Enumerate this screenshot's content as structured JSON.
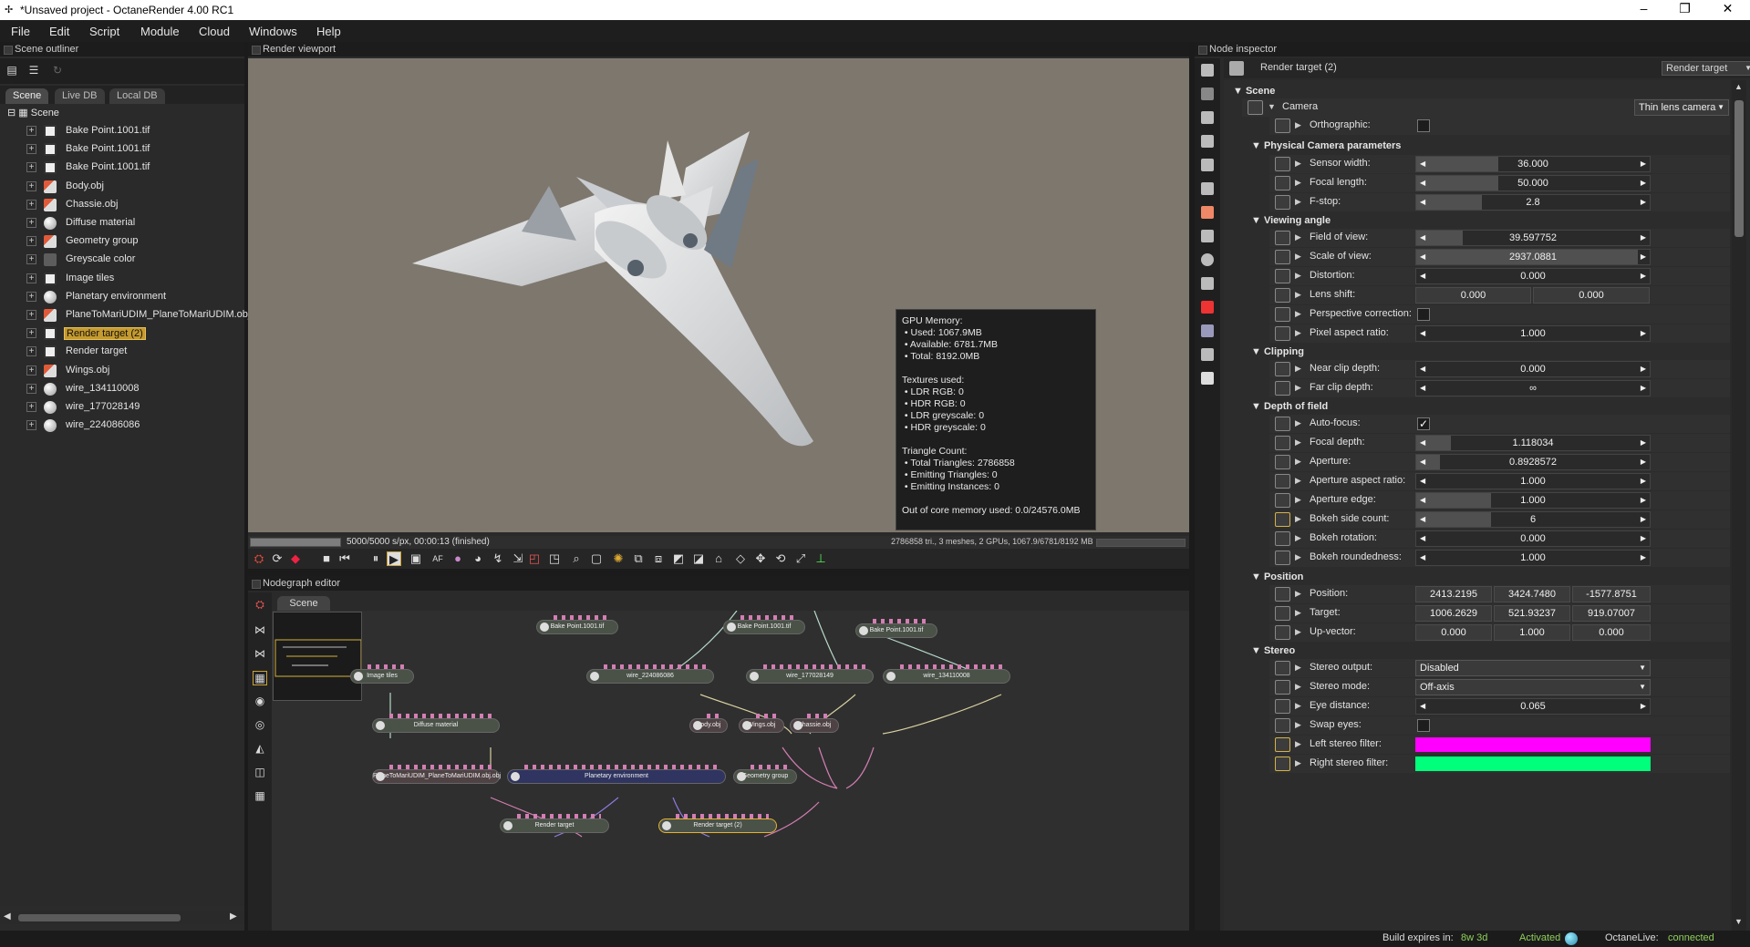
{
  "window": {
    "title": "*Unsaved project - OctaneRender 4.00 RC1",
    "minimize": "–",
    "maximize": "❐",
    "close": "✕"
  },
  "menu": [
    "File",
    "Edit",
    "Script",
    "Module",
    "Cloud",
    "Windows",
    "Help"
  ],
  "outliner": {
    "title": "Scene outliner",
    "tabs": [
      "Scene",
      "Live DB",
      "Local DB"
    ],
    "root": "Scene",
    "items": [
      {
        "label": "Bake Point.1001.tif",
        "icon": "texture-icon"
      },
      {
        "label": "Bake Point.1001.tif",
        "icon": "texture-icon"
      },
      {
        "label": "Bake Point.1001.tif",
        "icon": "texture-icon"
      },
      {
        "label": "Body.obj",
        "icon": "mesh-icon"
      },
      {
        "label": "Chassie.obj",
        "icon": "mesh-icon"
      },
      {
        "label": "Diffuse material",
        "icon": "material-icon"
      },
      {
        "label": "Geometry group",
        "icon": "group-icon"
      },
      {
        "label": "Greyscale color",
        "icon": "color-icon"
      },
      {
        "label": "Image tiles",
        "icon": "texture-icon"
      },
      {
        "label": "Planetary environment",
        "icon": "environment-icon"
      },
      {
        "label": "PlaneToMariUDIM_PlaneToMariUDIM.obj",
        "icon": "mesh-icon"
      },
      {
        "label": "Render target (2)",
        "icon": "render-target-icon",
        "selected": true
      },
      {
        "label": "Render target",
        "icon": "render-target-icon"
      },
      {
        "label": "Wings.obj",
        "icon": "mesh-icon"
      },
      {
        "label": "wire_134110008",
        "icon": "material-icon"
      },
      {
        "label": "wire_177028149",
        "icon": "material-icon"
      },
      {
        "label": "wire_224086086",
        "icon": "material-icon"
      }
    ]
  },
  "viewport": {
    "title": "Render viewport",
    "progress_text": "5000/5000 s/px, 00:00:13 (finished)",
    "progress": 1.0,
    "stats": "2786858 tri., 3 meshes, 2 GPUs, 1067.9/6781/8192 MB",
    "gpu_info": [
      "GPU Memory:",
      " • Used: 1067.9MB",
      " • Available: 6781.7MB",
      " • Total: 8192.0MB",
      "",
      "Textures used:",
      " • LDR RGB: 0",
      " • HDR RGB: 0",
      " • LDR greyscale: 0",
      " • HDR greyscale: 0",
      "",
      "Triangle Count:",
      " • Total Triangles: 2786858",
      " • Emitting Triangles: 0",
      " • Emitting Instances: 0",
      "",
      "Out of core memory used: 0.0/24576.0MB"
    ]
  },
  "nodegraph": {
    "title": "Nodegraph editor",
    "tab": "Scene",
    "nodes": [
      {
        "label": "Bake Point.1001.tif"
      },
      {
        "label": "Bake Point.1001.tif"
      },
      {
        "label": "Bake Point.1001.tif"
      },
      {
        "label": "Image tiles"
      },
      {
        "label": "wire_224086086"
      },
      {
        "label": "wire_177028149"
      },
      {
        "label": "wire_134110008"
      },
      {
        "label": "Diffuse material"
      },
      {
        "label": "Body.obj"
      },
      {
        "label": "Wings.obj"
      },
      {
        "label": "Chassie.obj"
      },
      {
        "label": "PlaneToMariUDIM_PlaneToMariUDIM.obj.obj"
      },
      {
        "label": "Planetary environment"
      },
      {
        "label": "Geometry group"
      },
      {
        "label": "Render target"
      },
      {
        "label": "Render target (2)"
      }
    ]
  },
  "inspector": {
    "title": "Node inspector",
    "node_name": "Render target (2)",
    "node_type": "Render target",
    "scene_label": "Scene",
    "camera_label": "Camera",
    "camera_type": "Thin lens camera",
    "orthographic": "Orthographic:",
    "sections": {
      "physical": "Physical Camera parameters",
      "viewing": "Viewing angle",
      "clipping": "Clipping",
      "dof": "Depth of field",
      "position": "Position",
      "stereo": "Stereo"
    },
    "props": {
      "sensor_width": {
        "label": "Sensor width:",
        "value": "36.000"
      },
      "focal_length": {
        "label": "Focal length:",
        "value": "50.000"
      },
      "fstop": {
        "label": "F-stop:",
        "value": "2.8"
      },
      "fov": {
        "label": "Field of view:",
        "value": "39.597752"
      },
      "scale": {
        "label": "Scale of view:",
        "value": "2937.0881"
      },
      "distortion": {
        "label": "Distortion:",
        "value": "0.000"
      },
      "lens_shift": {
        "label": "Lens shift:",
        "x": "0.000",
        "y": "0.000"
      },
      "perspective": {
        "label": "Perspective correction:"
      },
      "pixel_aspect": {
        "label": "Pixel aspect ratio:",
        "value": "1.000"
      },
      "near_clip": {
        "label": "Near clip depth:",
        "value": "0.000"
      },
      "far_clip": {
        "label": "Far clip depth:",
        "value": "∞"
      },
      "autofocus": {
        "label": "Auto-focus:",
        "check": "✓"
      },
      "focal_depth": {
        "label": "Focal depth:",
        "value": "1.118034"
      },
      "aperture": {
        "label": "Aperture:",
        "value": "0.8928572"
      },
      "aperture_ratio": {
        "label": "Aperture aspect ratio:",
        "value": "1.000"
      },
      "aperture_edge": {
        "label": "Aperture edge:",
        "value": "1.000"
      },
      "bokeh_count": {
        "label": "Bokeh side count:",
        "value": "6"
      },
      "bokeh_rotation": {
        "label": "Bokeh rotation:",
        "value": "0.000"
      },
      "bokeh_roundedness": {
        "label": "Bokeh roundedness:",
        "value": "1.000"
      },
      "position": {
        "label": "Position:",
        "x": "2413.2195",
        "y": "3424.7480",
        "z": "-1577.8751"
      },
      "target": {
        "label": "Target:",
        "x": "1006.2629",
        "y": "521.93237",
        "z": "919.07007"
      },
      "up": {
        "label": "Up-vector:",
        "x": "0.000",
        "y": "1.000",
        "z": "0.000"
      },
      "stereo_output": {
        "label": "Stereo output:",
        "value": "Disabled"
      },
      "stereo_mode": {
        "label": "Stereo mode:",
        "value": "Off-axis"
      },
      "eye_distance": {
        "label": "Eye distance:",
        "value": "0.065"
      },
      "swap_eyes": {
        "label": "Swap eyes:"
      },
      "left_filter": {
        "label": "Left stereo filter:",
        "color": "#ff00ff"
      },
      "right_filter": {
        "label": "Right stereo filter:",
        "color": "#00ff7a"
      }
    }
  },
  "status": {
    "build_label": "Build expires in:",
    "build_value": "8w 3d",
    "activated": "Activated",
    "live_label": "OctaneLive:",
    "live_value": "connected"
  }
}
